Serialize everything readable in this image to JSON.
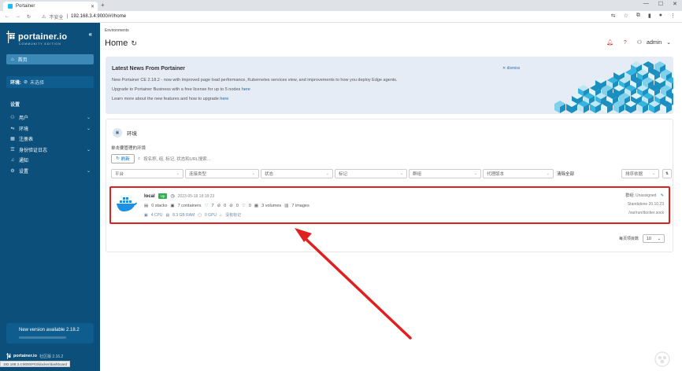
{
  "browser": {
    "tab_title": "Portainer",
    "new_tab": "+",
    "insecure_label": "不安全",
    "url": "192.168.3.4:9000/#!/home",
    "status_url": "192.168.3.4:9000/#!/3/docker/dashboard"
  },
  "sidebar": {
    "logo_word": "portainer.io",
    "logo_sub": "COMMUNITY EDITION",
    "home_label": "首页",
    "env_label": "环境:",
    "env_value": "未选择",
    "section_title": "设置",
    "items": [
      {
        "label": "用户",
        "icon": "user-icon",
        "chevron": true
      },
      {
        "label": "环境",
        "icon": "environment-icon",
        "chevron": true
      },
      {
        "label": "注册表",
        "icon": "registry-icon",
        "chevron": false
      },
      {
        "label": "身份验证日志",
        "icon": "log-icon",
        "chevron": true
      },
      {
        "label": "通知",
        "icon": "bell-icon",
        "chevron": false
      },
      {
        "label": "设置",
        "icon": "gear-icon",
        "chevron": true
      }
    ],
    "update_text": "New version available 2.18.2",
    "footer_name": "portainer.io",
    "footer_version": "社区版 2.16.2"
  },
  "header": {
    "breadcrumb": "Environments",
    "title": "Home",
    "user": "admin"
  },
  "news": {
    "title": "Latest News From Portainer",
    "dismiss": "dismiss",
    "line1": "New Portainer CE 2.18.2 - now with improved page load performance, Kubernetes services view, and improvements to how you deploy Edge agents.",
    "line2_prefix": "Upgrade to Portainer Business with a free license for up to 5 nodes",
    "line2_link": "here",
    "line3_prefix": "Learn more about the new features and how to upgrade",
    "line3_link": "here"
  },
  "env_panel": {
    "title": "环境",
    "hint": "单击要管理的环境",
    "refresh": "刷新",
    "search_placeholder": "按名称, 组, 标记, 状态和URL搜索...",
    "filters": [
      "平台",
      "连接类型",
      "状态",
      "标记",
      "群组",
      "代理版本"
    ],
    "clear_all": "清除全部",
    "sort_by": "排序依据",
    "environment": {
      "name": "local",
      "status": "Up",
      "timestamp": "2023-05-18 18:18:23",
      "stacks": "0 stacks",
      "containers": "7 containers",
      "healthy": "7",
      "unhealthy": "0",
      "stopped": "0",
      "paused": "0",
      "volumes": "3 volumes",
      "images": "7 images",
      "cpu": "4 CPU",
      "ram": "8.3 GB RAM",
      "gpu": "0 GPU",
      "tags": "没有标记",
      "group_label": "群组:",
      "group": "Unassigned",
      "engine": "Standalone 20.10.23",
      "socket": "/var/run/docker.sock"
    },
    "per_page_label": "每页项目数",
    "per_page": "10"
  },
  "colors": {
    "sidebar": "#0b4f7a",
    "accent": "#0b6bb0",
    "highlight": "#e02020",
    "up": "#2bb24c"
  }
}
